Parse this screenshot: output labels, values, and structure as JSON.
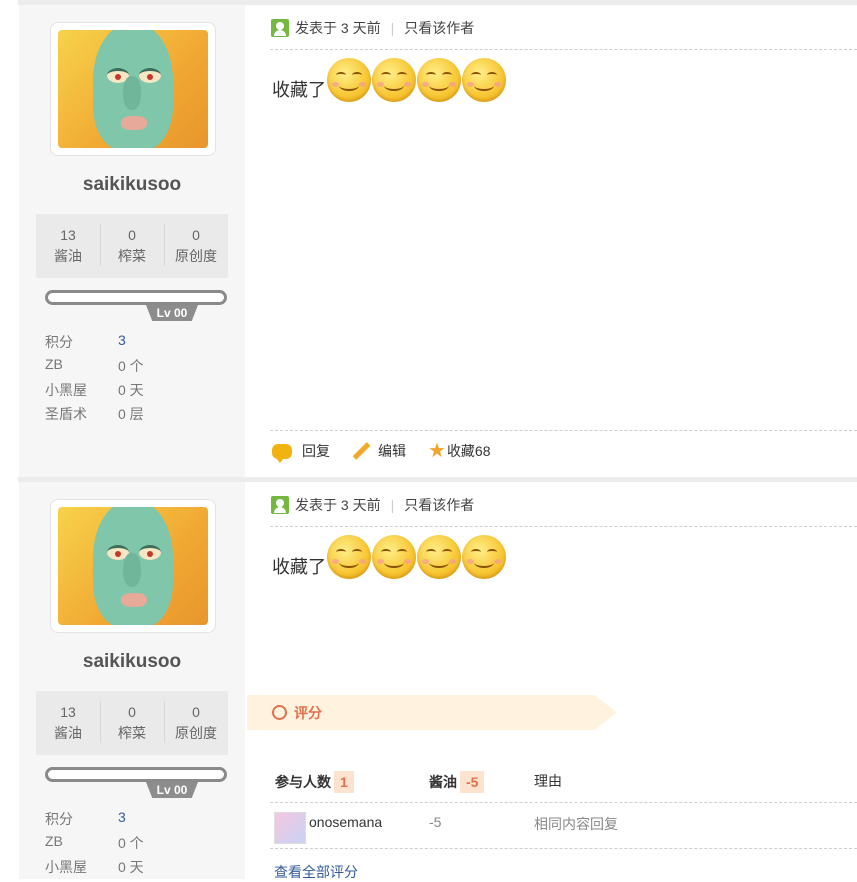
{
  "posts": [
    {
      "user": {
        "name": "saikikusoo",
        "stats": [
          {
            "value": "13",
            "label": "酱油"
          },
          {
            "value": "0",
            "label": "榨菜"
          },
          {
            "value": "0",
            "label": "原创度"
          }
        ],
        "level": "Lv 00",
        "info": [
          {
            "key": "积分",
            "value": "3"
          },
          {
            "key": "ZB",
            "value": "0 个"
          },
          {
            "key": "小黑屋",
            "value": "0 天"
          },
          {
            "key": "圣盾术",
            "value": "0 层"
          }
        ]
      },
      "meta": {
        "posted": "发表于 3 天前",
        "only_author": "只看该作者"
      },
      "content": {
        "text": "收藏了",
        "emoji_count": 4
      },
      "actions": {
        "reply": "回复",
        "edit": "编辑",
        "favorite": "收藏68"
      }
    },
    {
      "user": {
        "name": "saikikusoo",
        "stats": [
          {
            "value": "13",
            "label": "酱油"
          },
          {
            "value": "0",
            "label": "榨菜"
          },
          {
            "value": "0",
            "label": "原创度"
          }
        ],
        "level": "Lv 00",
        "info": [
          {
            "key": "积分",
            "value": "3"
          },
          {
            "key": "ZB",
            "value": "0 个"
          },
          {
            "key": "小黑屋",
            "value": "0 天"
          }
        ]
      },
      "meta": {
        "posted": "发表于 3 天前",
        "only_author": "只看该作者"
      },
      "content": {
        "text": "收藏了",
        "emoji_count": 4
      },
      "rating": {
        "title": "评分",
        "participants_label": "参与人数",
        "participants": "1",
        "soy_label": "酱油",
        "soy_total": "-5",
        "reason_label": "理由",
        "rows": [
          {
            "user": "onosemana",
            "soy": "-5",
            "reason": "相同内容回复"
          }
        ],
        "view_all": "查看全部评分"
      }
    }
  ],
  "colors": {
    "accent_orange": "#e0704b",
    "link_blue": "#335b9a",
    "author_green": "#74b83f"
  }
}
